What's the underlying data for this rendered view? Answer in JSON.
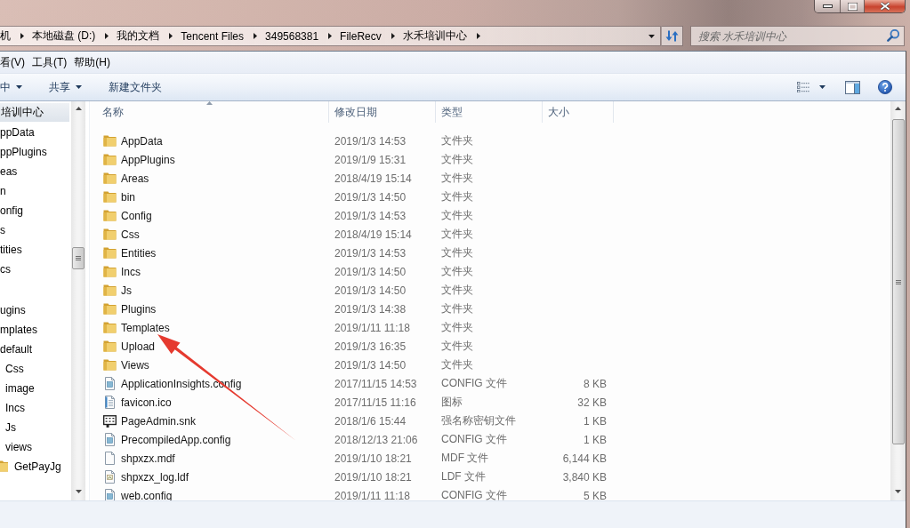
{
  "address_bar": {
    "crumbs": [
      "机",
      "本地磁盘 (D:)",
      "我的文档",
      "Tencent Files",
      "349568381",
      "FileRecv",
      "水禾培训中心"
    ]
  },
  "search": {
    "placeholder": "搜索 水禾培训中心"
  },
  "menu_bar": {
    "items": [
      "看(V)",
      "工具(T)",
      "帮助(H)"
    ]
  },
  "toolbar": {
    "buttons": [
      {
        "label": "中",
        "dropdown": true
      },
      {
        "label": "共享",
        "dropdown": true
      },
      {
        "label": "新建文件夹",
        "dropdown": false
      }
    ]
  },
  "nav_tree": {
    "items": [
      {
        "kind": "label",
        "label": "培训中心",
        "selected": true,
        "children": [
          {
            "kind": "label",
            "label": "ppData",
            "selected": false
          },
          {
            "kind": "label",
            "label": "ppPlugins",
            "selected": false
          },
          {
            "kind": "label",
            "label": "eas",
            "selected": false
          },
          {
            "kind": "label",
            "label": "n",
            "selected": false
          },
          {
            "kind": "label",
            "label": "onfig",
            "selected": false
          },
          {
            "kind": "label",
            "label": "s",
            "selected": false
          },
          {
            "kind": "label",
            "label": "tities",
            "selected": false
          },
          {
            "kind": "label",
            "label": "cs",
            "selected": false
          },
          {
            "kind": "blank"
          },
          {
            "kind": "label",
            "label": "ugins",
            "selected": false
          },
          {
            "kind": "label",
            "label": "mplates",
            "selected": false,
            "children": [
              {
                "kind": "label",
                "label": "default",
                "selected": false,
                "children": [
                  {
                    "kind": "label",
                    "label": "Css",
                    "selected": false
                  },
                  {
                    "kind": "label",
                    "label": "image",
                    "selected": false
                  },
                  {
                    "kind": "label",
                    "label": "Incs",
                    "selected": false
                  },
                  {
                    "kind": "label",
                    "label": "Js",
                    "selected": false
                  },
                  {
                    "kind": "label",
                    "label": "views",
                    "selected": false,
                    "children": [
                      {
                        "kind": "folder",
                        "label": "GetPayJg",
                        "selected": false
                      }
                    ]
                  }
                ]
              }
            ]
          }
        ]
      }
    ]
  },
  "file_list": {
    "columns": [
      {
        "label": "名称",
        "sorted": true
      },
      {
        "label": "修改日期",
        "sorted": false
      },
      {
        "label": "类型",
        "sorted": false
      },
      {
        "label": "大小",
        "sorted": false
      }
    ],
    "rows": [
      {
        "kind": "folder",
        "name": "AppData",
        "modified": "2019/1/3 14:53",
        "type": "文件夹",
        "selected": false
      },
      {
        "kind": "folder",
        "name": "AppPlugins",
        "modified": "2019/1/9 15:31",
        "type": "文件夹",
        "selected": false
      },
      {
        "kind": "folder",
        "name": "Areas",
        "modified": "2018/4/19 15:14",
        "type": "文件夹",
        "selected": false
      },
      {
        "kind": "folder",
        "name": "bin",
        "modified": "2019/1/3 14:50",
        "type": "文件夹",
        "selected": false
      },
      {
        "kind": "folder",
        "name": "Config",
        "modified": "2019/1/3 14:53",
        "type": "文件夹",
        "selected": false
      },
      {
        "kind": "folder",
        "name": "Css",
        "modified": "2018/4/19 15:14",
        "type": "文件夹",
        "selected": false
      },
      {
        "kind": "folder",
        "name": "Entities",
        "modified": "2019/1/3 14:53",
        "type": "文件夹",
        "selected": false
      },
      {
        "kind": "folder",
        "name": "Incs",
        "modified": "2019/1/3 14:50",
        "type": "文件夹",
        "selected": false
      },
      {
        "kind": "folder",
        "name": "Js",
        "modified": "2019/1/3 14:50",
        "type": "文件夹",
        "selected": false
      },
      {
        "kind": "folder",
        "name": "Plugins",
        "modified": "2019/1/3 14:38",
        "type": "文件夹",
        "selected": false
      },
      {
        "kind": "folder",
        "name": "Templates",
        "modified": "2019/1/11 11:18",
        "type": "文件夹",
        "selected": false
      },
      {
        "kind": "folder",
        "name": "Upload",
        "modified": "2019/1/3 16:35",
        "type": "文件夹",
        "selected": false
      },
      {
        "kind": "folder",
        "name": "Views",
        "modified": "2019/1/3 14:50",
        "type": "文件夹",
        "selected": false
      },
      {
        "kind": "config",
        "name": "ApplicationInsights.config",
        "modified": "2017/11/15 14:53",
        "type": "CONFIG 文件",
        "size": "8 KB",
        "selected": false
      },
      {
        "kind": "image",
        "name": "favicon.ico",
        "modified": "2017/11/15 11:16",
        "type": "图标",
        "size": "32 KB",
        "selected": false
      },
      {
        "kind": "key",
        "name": "PageAdmin.snk",
        "modified": "2018/1/6 15:44",
        "type": "强名称密钥文件",
        "size": "1 KB",
        "selected": false
      },
      {
        "kind": "config",
        "name": "PrecompiledApp.config",
        "modified": "2018/12/13 21:06",
        "type": "CONFIG 文件",
        "size": "1 KB",
        "selected": false
      },
      {
        "kind": "plain",
        "name": "shpxzx.mdf",
        "modified": "2019/1/10 18:21",
        "type": "MDF 文件",
        "size": "6,144 KB",
        "selected": false
      },
      {
        "kind": "log",
        "name": "shpxzx_log.ldf",
        "modified": "2019/1/10 18:21",
        "type": "LDF 文件",
        "size": "3,840 KB",
        "selected": false
      },
      {
        "kind": "config",
        "name": "web.config",
        "modified": "2019/1/11 11:18",
        "type": "CONFIG 文件",
        "size": "5 KB",
        "selected": false
      }
    ]
  },
  "annotations": [
    {
      "kind": "arrow"
    }
  ]
}
